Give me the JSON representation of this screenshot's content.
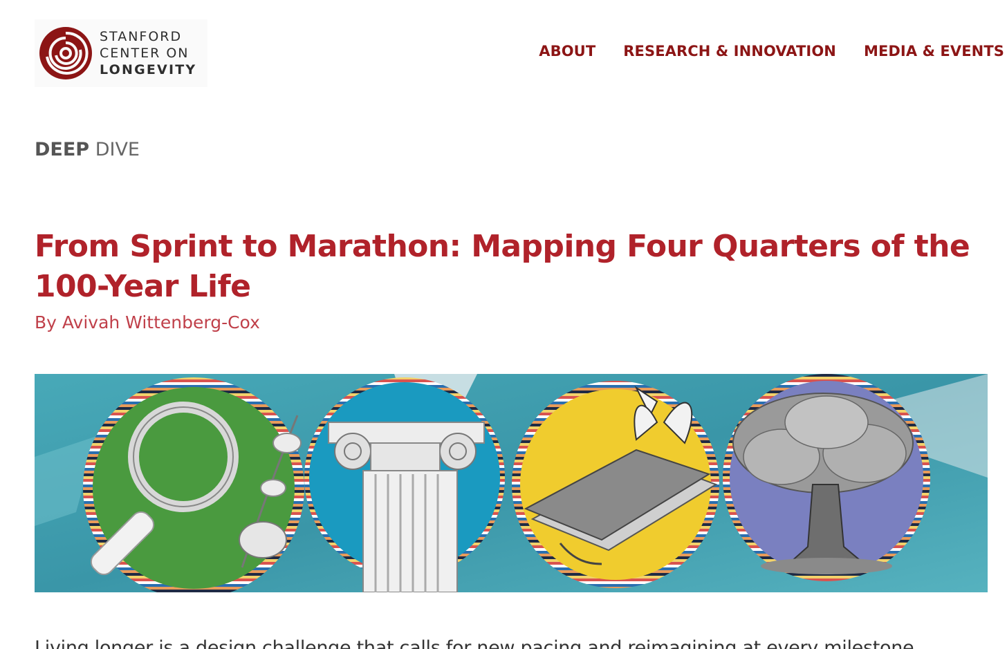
{
  "header": {
    "logo": {
      "line1": "STANFORD",
      "line2": "CENTER ON",
      "line3": "LONGEVITY"
    },
    "nav": [
      {
        "label": "ABOUT"
      },
      {
        "label": "RESEARCH & INNOVATION"
      },
      {
        "label": "MEDIA & EVENTS"
      }
    ]
  },
  "article": {
    "kicker_strong": "DEEP",
    "kicker_light": "DIVE",
    "title": "From Sprint to Marathon: Mapping Four Quarters of the 100-Year Life",
    "byline": "By Avivah Wittenberg-Cox",
    "banner": {
      "icons": [
        "magnifying-glass-icon",
        "ionic-column-icon",
        "journal-butterfly-icon",
        "oak-tree-icon"
      ],
      "circle_colors": [
        "#4a9a3f",
        "#1a9ac0",
        "#f0cc2e",
        "#7a80c0"
      ],
      "background_color": "#3fa0b0"
    },
    "lede": "Living longer is a design challenge that calls for new pacing and reimagining at every milestone."
  },
  "colors": {
    "brand": "#8c1515",
    "title": "#b0222a",
    "byline": "#c0404a"
  }
}
